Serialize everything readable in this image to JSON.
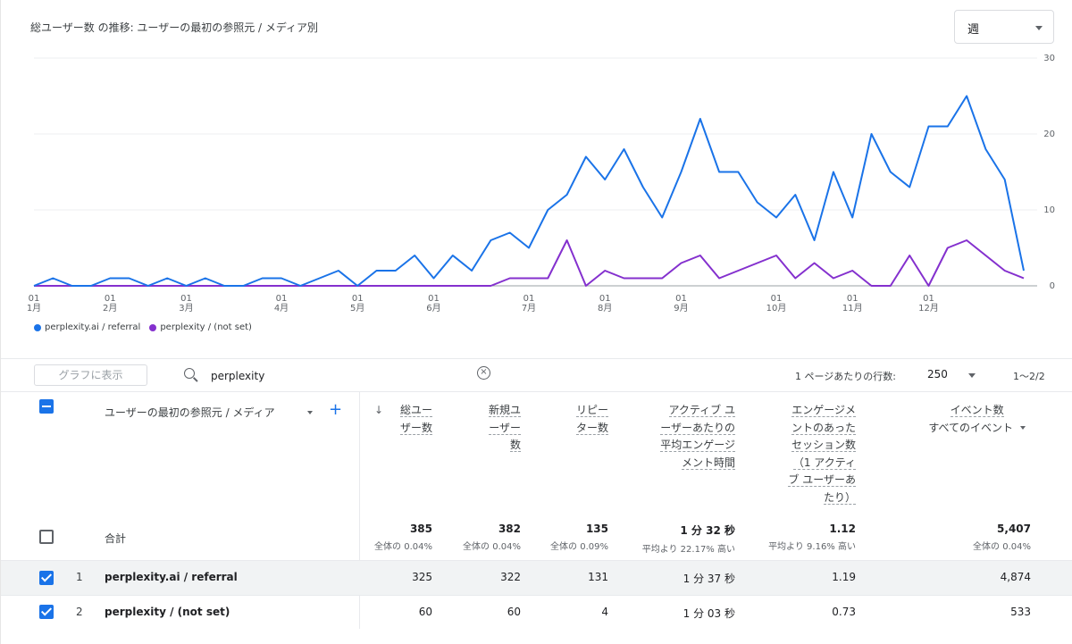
{
  "header": {
    "title": "総ユーザー数 の推移: ユーザーの最初の参照元 / メディア別",
    "period": "週"
  },
  "chart_data": {
    "type": "line",
    "x_labels": [
      {
        "day": "01",
        "month": "1月",
        "week": 0
      },
      {
        "day": "01",
        "month": "2月",
        "week": 4
      },
      {
        "day": "01",
        "month": "3月",
        "week": 8
      },
      {
        "day": "01",
        "month": "4月",
        "week": 13
      },
      {
        "day": "01",
        "month": "5月",
        "week": 17
      },
      {
        "day": "01",
        "month": "6月",
        "week": 21
      },
      {
        "day": "01",
        "month": "7月",
        "week": 26
      },
      {
        "day": "01",
        "month": "8月",
        "week": 30
      },
      {
        "day": "01",
        "month": "9月",
        "week": 34
      },
      {
        "day": "01",
        "month": "10月",
        "week": 39
      },
      {
        "day": "01",
        "month": "11月",
        "week": 43
      },
      {
        "day": "01",
        "month": "12月",
        "week": 47
      }
    ],
    "y_ticks": [
      0,
      10,
      20,
      30
    ],
    "ylim": [
      0,
      30
    ],
    "series": [
      {
        "name": "perplexity.ai / referral",
        "color": "#1a73e8",
        "values": [
          0,
          1,
          0,
          0,
          1,
          1,
          0,
          1,
          0,
          1,
          0,
          0,
          1,
          1,
          0,
          1,
          2,
          0,
          2,
          2,
          4,
          1,
          4,
          2,
          6,
          7,
          5,
          10,
          12,
          17,
          14,
          18,
          13,
          9,
          15,
          22,
          15,
          15,
          11,
          9,
          12,
          6,
          15,
          9,
          20,
          15,
          13,
          21,
          21,
          25,
          18,
          14,
          2
        ]
      },
      {
        "name": "perplexity / (not set)",
        "color": "#8430ce",
        "values": [
          0,
          0,
          0,
          0,
          0,
          0,
          0,
          0,
          0,
          0,
          0,
          0,
          0,
          0,
          0,
          0,
          0,
          0,
          0,
          0,
          0,
          0,
          0,
          0,
          0,
          1,
          1,
          1,
          6,
          0,
          2,
          1,
          1,
          1,
          3,
          4,
          1,
          2,
          3,
          4,
          1,
          3,
          1,
          2,
          0,
          0,
          4,
          0,
          5,
          6,
          4,
          2,
          1
        ]
      }
    ]
  },
  "toolbar": {
    "show_graph": "グラフに表示",
    "search_value": "perplexity",
    "clear_symbol": "×",
    "rows_label": "1 ページあたりの行数:",
    "rows_value": "250",
    "pager": "1〜2/2"
  },
  "table": {
    "dimension_header": "ユーザーの最初の参照元 / メディア",
    "sort_arrow": "↓",
    "plus": "+",
    "metric_headers": {
      "total_users": [
        "総ユー",
        "ザー数"
      ],
      "new_users": [
        "新規ユ",
        "ーザー",
        "数"
      ],
      "returning": [
        "リピー",
        "ター数"
      ],
      "avg_engagement": [
        "アクティブ ユ",
        "ーザーあたりの",
        "平均エンゲージ",
        "メント時間"
      ],
      "engaged_sessions": [
        "エンゲージメ",
        "ントのあった",
        "セッション数",
        "（1 アクティ",
        "ブ ユーザーあ",
        "たり）"
      ],
      "events": [
        "イベント数",
        "すべてのイベント"
      ]
    },
    "totals": {
      "label": "合計",
      "total_users": {
        "value": "385",
        "sub": "全体の 0.04%"
      },
      "new_users": {
        "value": "382",
        "sub": "全体の 0.04%"
      },
      "returning": {
        "value": "135",
        "sub": "全体の 0.09%"
      },
      "avg_engagement": {
        "value": "1 分 32 秒",
        "sub": "平均より 22.17% 高い"
      },
      "engaged_sessions": {
        "value": "1.12",
        "sub": "平均より 9.16% 高い"
      },
      "events": {
        "value": "5,407",
        "sub": "全体の 0.04%"
      }
    },
    "rows": [
      {
        "num": "1",
        "name": "perplexity.ai / referral",
        "total_users": "325",
        "new_users": "322",
        "returning": "131",
        "avg_engagement": "1 分 37 秒",
        "engaged_sessions": "1.19",
        "events": "4,874"
      },
      {
        "num": "2",
        "name": "perplexity / (not set)",
        "total_users": "60",
        "new_users": "60",
        "returning": "4",
        "avg_engagement": "1 分 03 秒",
        "engaged_sessions": "0.73",
        "events": "533"
      }
    ]
  }
}
